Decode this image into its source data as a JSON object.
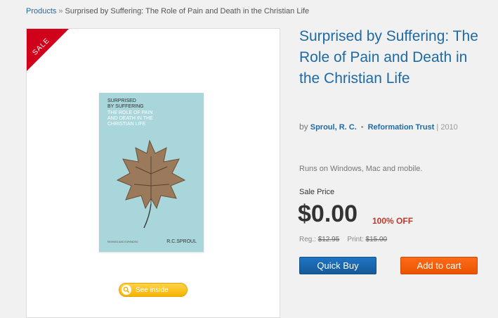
{
  "breadcrumb": {
    "root": "Products",
    "separator": "»",
    "current": "Surprised by Suffering: The Role of Pain and Death in the Christian Life"
  },
  "badge": {
    "sale": "SALE"
  },
  "cover": {
    "title_line1": "SURPRISED",
    "title_line2": "BY SUFFERING",
    "subtitle_line1": "THE ROLE OF PAIN",
    "subtitle_line2": "AND DEATH IN THE",
    "subtitle_line3": "CHRISTIAN LIFE",
    "edition": "REVISED AND EXPANDED",
    "author": "R.C.SPROUL"
  },
  "see_inside": {
    "label": "See inside"
  },
  "product": {
    "title": "Surprised by Suffering: The Role of Pain and Death in the Christian Life",
    "by": "by",
    "author": "Sproul, R. C.",
    "publisher": "Reformation Trust",
    "year": "| 2010",
    "platform_note": "Runs on Windows, Mac and mobile.",
    "sale_label": "Sale Price",
    "price": "$0.00",
    "discount": "100% OFF",
    "reg_label": "Reg.:",
    "reg_price": "$12.95",
    "print_label": "Print:",
    "print_price": "$15.00"
  },
  "buttons": {
    "quick_buy": "Quick Buy",
    "add_to_cart": "Add to cart"
  },
  "colors": {
    "link": "#1f6aa5",
    "sale_ribbon": "#d0021b",
    "quick_buy": "#1f74c3",
    "add_to_cart": "#ff6a1a",
    "see_inside": "#f5b400"
  }
}
